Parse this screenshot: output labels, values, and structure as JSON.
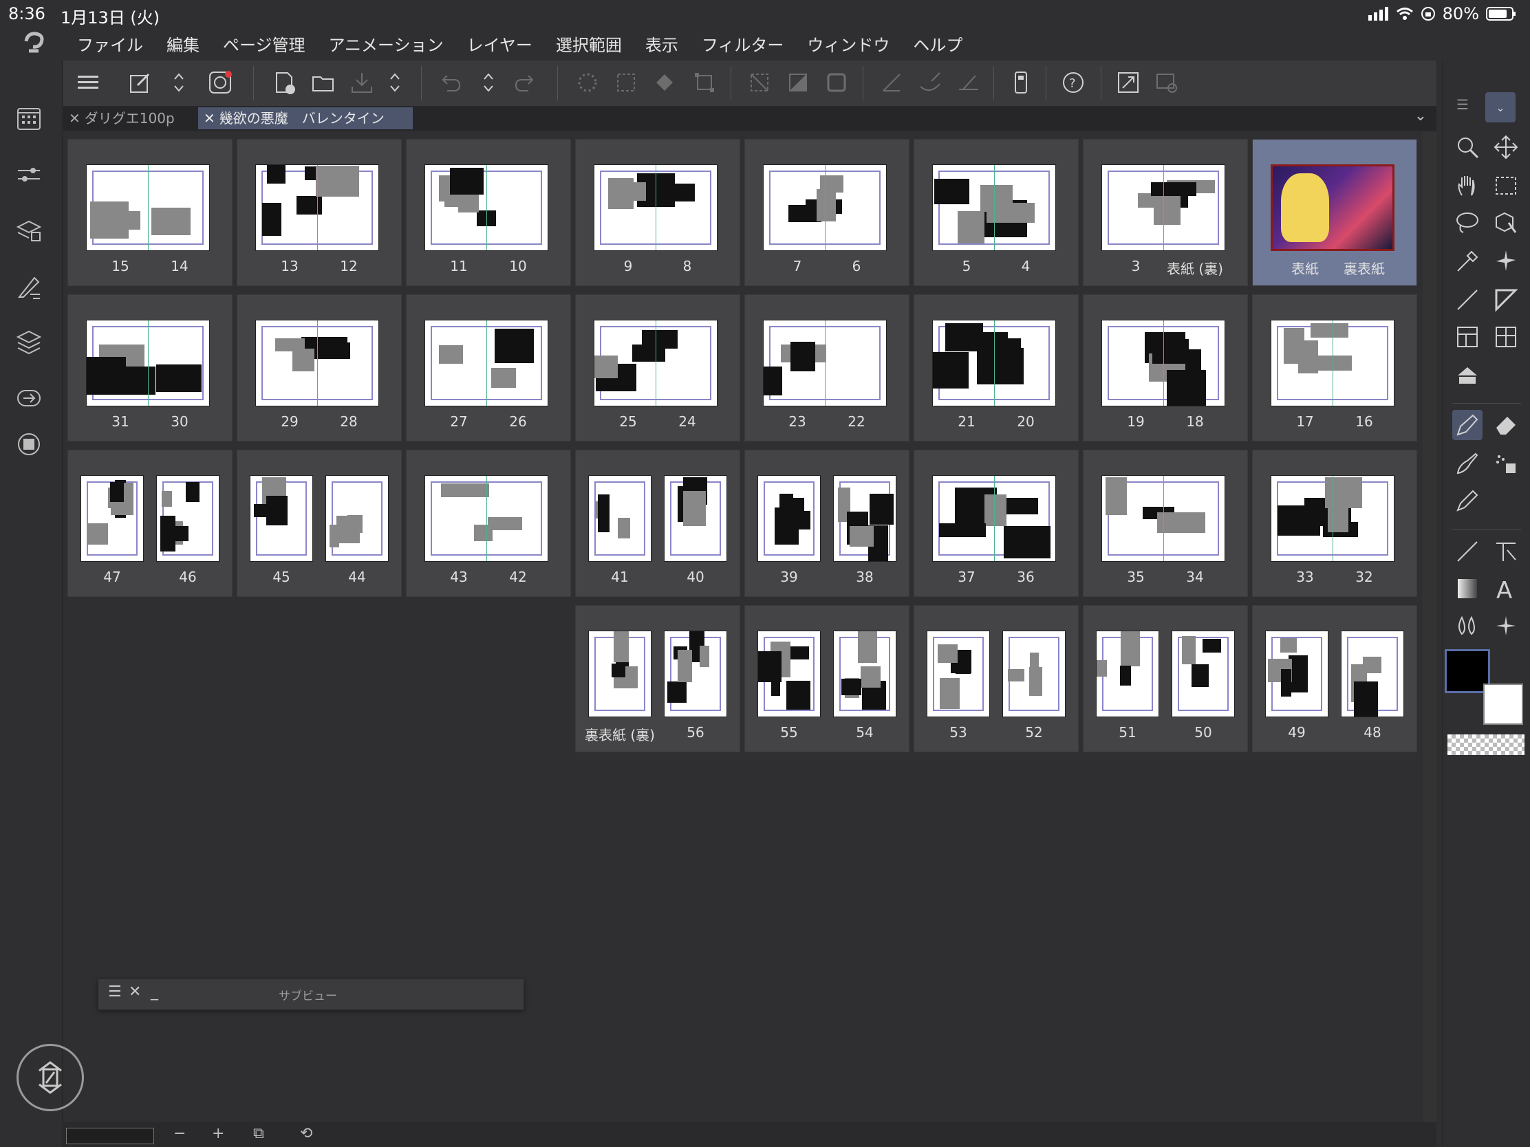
{
  "status": {
    "time": "8:36",
    "date": "1月13日 (火)",
    "battery": "80%"
  },
  "menu": [
    "ファイル",
    "編集",
    "ページ管理",
    "アニメーション",
    "レイヤー",
    "選択範囲",
    "表示",
    "フィルター",
    "ウィンドウ",
    "ヘルプ"
  ],
  "tabs": [
    {
      "label": "ダリグエ100p",
      "active": false
    },
    {
      "label": "幾欲の悪魔　バレンタイン",
      "active": true
    }
  ],
  "pages": [
    {
      "left": "15",
      "right": "14",
      "type": "spread"
    },
    {
      "left": "13",
      "right": "12",
      "type": "spread"
    },
    {
      "left": "11",
      "right": "10",
      "type": "spread"
    },
    {
      "left": "9",
      "right": "8",
      "type": "spread"
    },
    {
      "left": "7",
      "right": "6",
      "type": "spread"
    },
    {
      "left": "5",
      "right": "4",
      "type": "spread"
    },
    {
      "left": "3",
      "right": "表紙 (裏)",
      "type": "spread"
    },
    {
      "left": "表紙",
      "right": "裏表紙",
      "type": "cover",
      "selected": true
    },
    {
      "left": "31",
      "right": "30",
      "type": "spread"
    },
    {
      "left": "29",
      "right": "28",
      "type": "spread"
    },
    {
      "left": "27",
      "right": "26",
      "type": "spread"
    },
    {
      "left": "25",
      "right": "24",
      "type": "spread"
    },
    {
      "left": "23",
      "right": "22",
      "type": "spread"
    },
    {
      "left": "21",
      "right": "20",
      "type": "spread"
    },
    {
      "left": "19",
      "right": "18",
      "type": "spread"
    },
    {
      "left": "17",
      "right": "16",
      "type": "spread"
    },
    {
      "left": "47",
      "right": "46",
      "type": "pair"
    },
    {
      "left": "45",
      "right": "44",
      "type": "pair"
    },
    {
      "left": "43",
      "right": "42",
      "type": "spread"
    },
    {
      "left": "41",
      "right": "40",
      "type": "pair"
    },
    {
      "left": "39",
      "right": "38",
      "type": "pair"
    },
    {
      "left": "37",
      "right": "36",
      "type": "spread"
    },
    {
      "left": "35",
      "right": "34",
      "type": "spread"
    },
    {
      "left": "33",
      "right": "32",
      "type": "spread"
    },
    {
      "left": "裏表紙 (裏)",
      "right": "56",
      "type": "pair"
    },
    {
      "left": "55",
      "right": "54",
      "type": "pair"
    },
    {
      "left": "53",
      "right": "52",
      "type": "pair"
    },
    {
      "left": "51",
      "right": "50",
      "type": "pair"
    },
    {
      "left": "49",
      "right": "48",
      "type": "pair"
    }
  ],
  "subview": {
    "title": "サブビュー",
    "close": "✕",
    "minimize": "_",
    "menu": "☰"
  },
  "bottombar": {
    "minus": "−",
    "plus": "+"
  },
  "colors": {
    "main": "#000000",
    "sub": "#ffffff",
    "accent": "#4c556c"
  }
}
